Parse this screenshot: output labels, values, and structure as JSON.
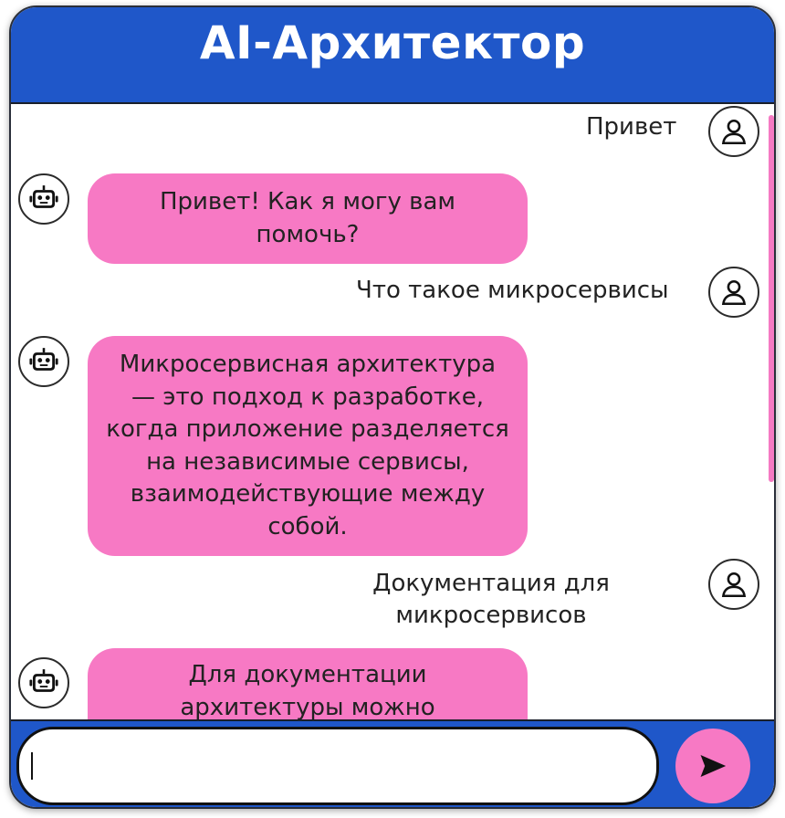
{
  "header": {
    "title": "AI-Архитектор"
  },
  "messages": [
    {
      "role": "user",
      "text": "Привет"
    },
    {
      "role": "bot",
      "text": "Привет! Как я могу вам помочь?"
    },
    {
      "role": "user",
      "text": "Что такое микросервисы"
    },
    {
      "role": "bot",
      "text": "Микросервисная архитектура — это подход к разработке, когда приложение разделяется на независимые сервисы, взаимодействующие между собой."
    },
    {
      "role": "user",
      "text": "Документация для микросервисов"
    },
    {
      "role": "bot",
      "text": "Для документации архитектуры можно"
    }
  ],
  "input": {
    "value": "",
    "placeholder": ""
  },
  "icons": {
    "user": "user-icon",
    "bot": "robot-icon",
    "send": "send-icon"
  },
  "colors": {
    "accent": "#1f57c9",
    "bubble": "#f779c4",
    "send_button": "#f779c4",
    "scrollbar": "#f57ac3"
  }
}
